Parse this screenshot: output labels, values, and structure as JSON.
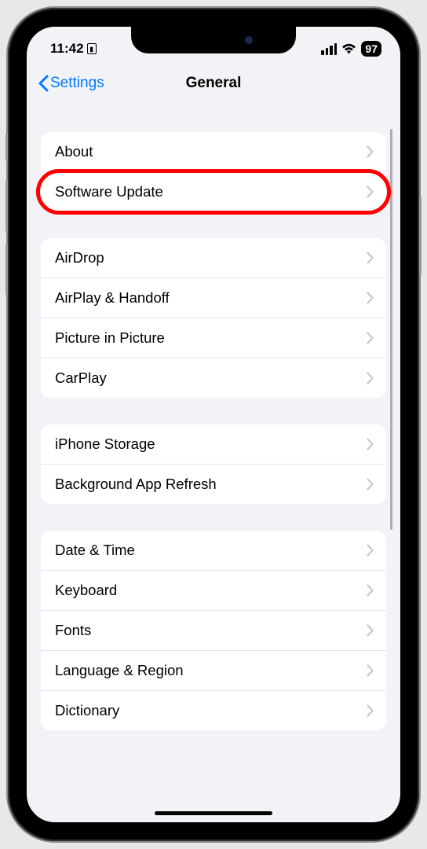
{
  "status": {
    "time": "11:42",
    "battery": "97"
  },
  "nav": {
    "back_label": "Settings",
    "title": "General"
  },
  "sections": [
    {
      "rows": [
        {
          "label": "About",
          "highlighted": false
        },
        {
          "label": "Software Update",
          "highlighted": true
        }
      ]
    },
    {
      "rows": [
        {
          "label": "AirDrop"
        },
        {
          "label": "AirPlay & Handoff"
        },
        {
          "label": "Picture in Picture"
        },
        {
          "label": "CarPlay"
        }
      ]
    },
    {
      "rows": [
        {
          "label": "iPhone Storage"
        },
        {
          "label": "Background App Refresh"
        }
      ]
    },
    {
      "rows": [
        {
          "label": "Date & Time"
        },
        {
          "label": "Keyboard"
        },
        {
          "label": "Fonts"
        },
        {
          "label": "Language & Region"
        },
        {
          "label": "Dictionary"
        }
      ]
    }
  ],
  "annotation": {
    "highlighted_row": "Software Update",
    "highlight_color": "#ff0000"
  }
}
